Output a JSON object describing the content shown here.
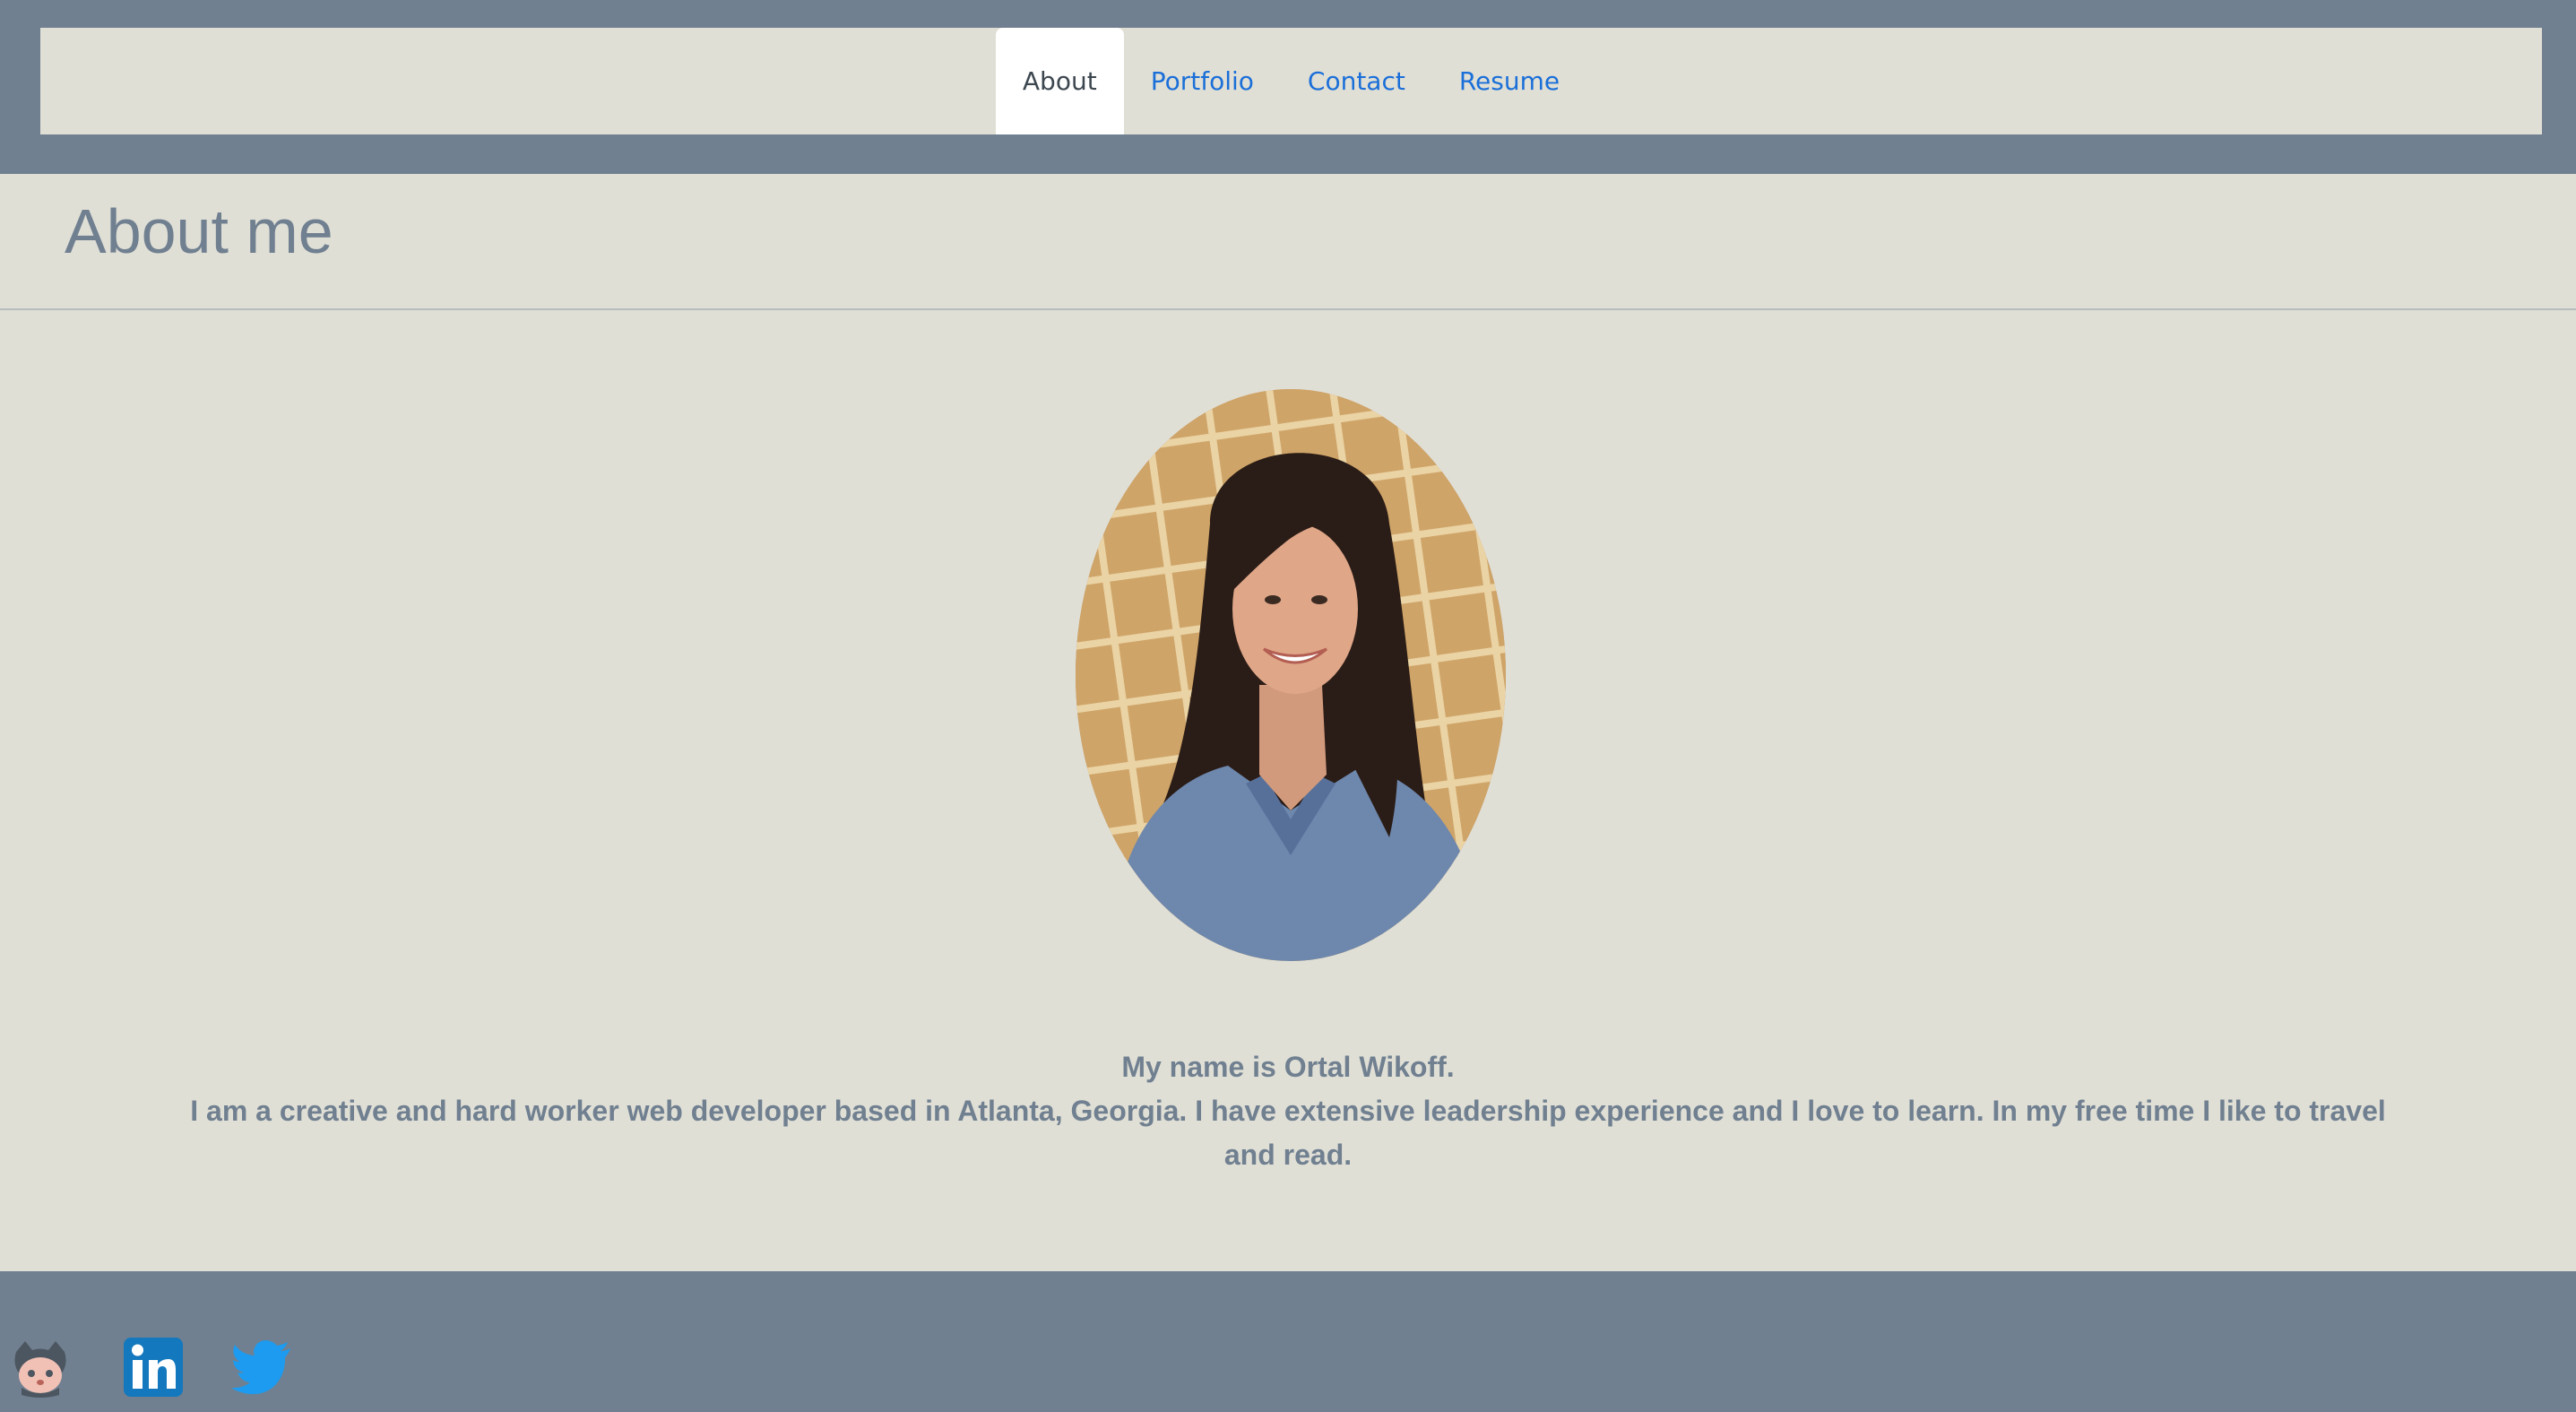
{
  "nav": {
    "tabs": [
      {
        "label": "About",
        "active": true
      },
      {
        "label": "Portfolio",
        "active": false
      },
      {
        "label": "Contact",
        "active": false
      },
      {
        "label": "Resume",
        "active": false
      }
    ]
  },
  "page": {
    "title": "About me"
  },
  "bio": {
    "intro": "My name is Ortal Wikoff.",
    "body": "I am a creative and hard worker web developer based in Atlanta, Georgia. I have extensive leadership experience and I love to learn. In my free time I like to travel and read."
  },
  "footer": {
    "links": [
      {
        "icon": "github-icon"
      },
      {
        "icon": "linkedin-icon"
      },
      {
        "icon": "twitter-icon"
      }
    ]
  },
  "colors": {
    "background": "#e0dfd6",
    "header": "#708090",
    "link": "#1a6fd8",
    "text": "#708090"
  }
}
